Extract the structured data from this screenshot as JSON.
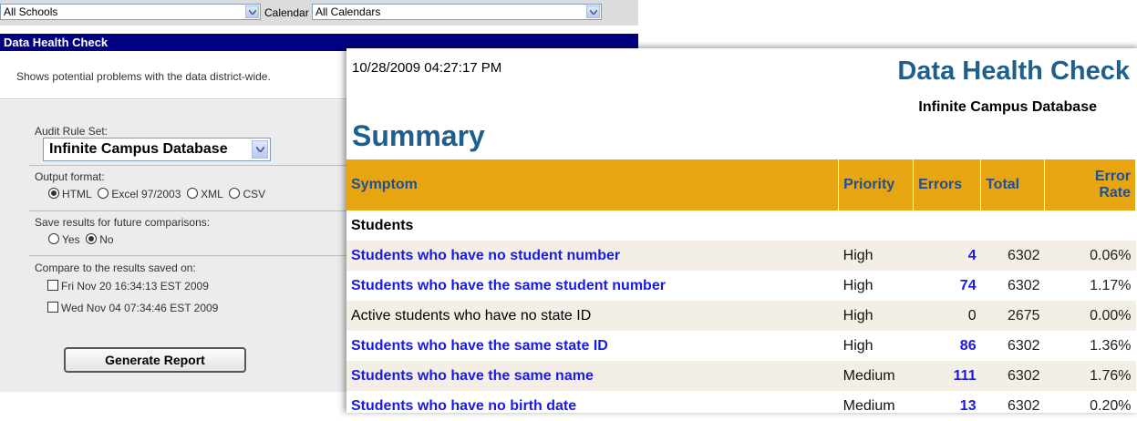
{
  "filters": {
    "school_value": "All Schools",
    "calendar_label": "Calendar",
    "calendar_value": "All Calendars"
  },
  "panel": {
    "title": "Data Health Check",
    "description": "Shows potential problems with the data district-wide.",
    "audit_label": "Audit Rule Set:",
    "audit_value": "Infinite Campus Database",
    "output_label": "Output format:",
    "output_options": [
      "HTML",
      "Excel 97/2003",
      "XML",
      "CSV"
    ],
    "output_selected": "HTML",
    "save_label": "Save results for future comparisons:",
    "save_options": [
      "Yes",
      "No"
    ],
    "save_selected": "No",
    "compare_label": "Compare to the results saved on:",
    "compare_options": [
      "Fri Nov 20 16:34:13 EST 2009",
      "Wed Nov 04 07:34:46 EST 2009"
    ],
    "generate_label": "Generate Report"
  },
  "report": {
    "timestamp": "10/28/2009 04:27:17 PM",
    "title": "Data Health Check",
    "subtitle": "Infinite Campus Database",
    "section": "Summary",
    "columns": [
      "Symptom",
      "Priority",
      "Errors",
      "Total",
      "Error Rate"
    ],
    "group": "Students",
    "rows": [
      {
        "symptom": "Students who have no student number",
        "priority": "High",
        "errors": "4",
        "total": "6302",
        "rate": "0.06%"
      },
      {
        "symptom": "Students who have the same student number",
        "priority": "High",
        "errors": "74",
        "total": "6302",
        "rate": "1.17%"
      },
      {
        "symptom": "Active students who have no state ID",
        "priority": "High",
        "errors": "0",
        "total": "2675",
        "rate": "0.00%"
      },
      {
        "symptom": "Students who have the same state ID",
        "priority": "High",
        "errors": "86",
        "total": "6302",
        "rate": "1.36%"
      },
      {
        "symptom": "Students who have the same name",
        "priority": "Medium",
        "errors": "111",
        "total": "6302",
        "rate": "1.76%"
      },
      {
        "symptom": "Students who have no birth date",
        "priority": "Medium",
        "errors": "13",
        "total": "6302",
        "rate": "0.20%"
      }
    ]
  }
}
